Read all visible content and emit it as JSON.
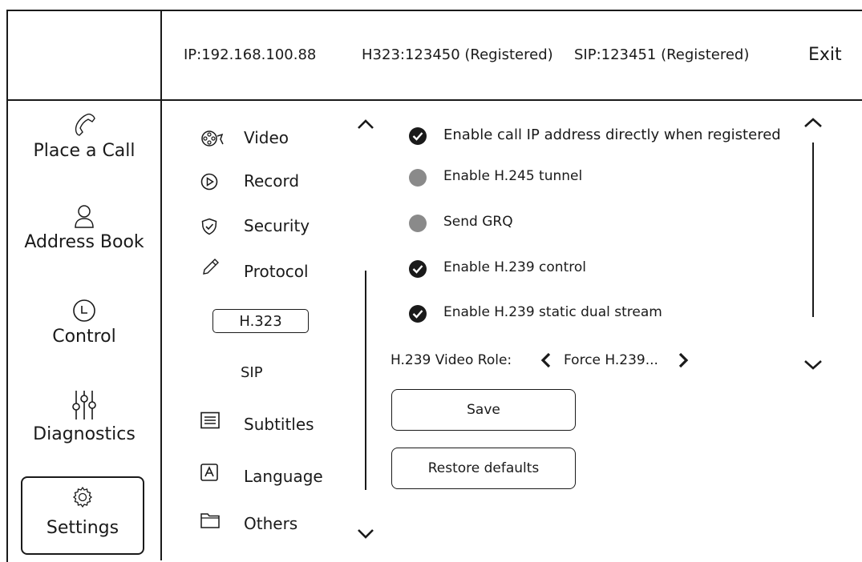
{
  "header": {
    "ip": "IP:192.168.100.88",
    "h323": "H323:123450 (Registered)",
    "sip": "SIP:123451 (Registered)",
    "exit_label": "Exit"
  },
  "sidebar": {
    "items": [
      {
        "label": "Place a Call",
        "icon": "phone-icon"
      },
      {
        "label": "Address Book",
        "icon": "person-icon"
      },
      {
        "label": "Control",
        "icon": "clock-icon"
      },
      {
        "label": "Diagnostics",
        "icon": "sliders-icon"
      },
      {
        "label": "Settings",
        "icon": "gear-icon",
        "selected": true
      }
    ]
  },
  "menu": {
    "items": [
      {
        "label": "Video",
        "icon": "video-icon"
      },
      {
        "label": "Record",
        "icon": "record-icon"
      },
      {
        "label": "Security",
        "icon": "shield-icon"
      },
      {
        "label": "Protocol",
        "icon": "pencil-icon"
      },
      {
        "label": "Subtitles",
        "icon": "subtitles-icon"
      },
      {
        "label": "Language",
        "icon": "language-icon"
      },
      {
        "label": "Others",
        "icon": "folder-icon"
      }
    ],
    "sub_items": [
      {
        "label": "H.323",
        "selected": true
      },
      {
        "label": "SIP",
        "selected": false
      }
    ]
  },
  "options": [
    {
      "label": "Enable call IP address directly when registered",
      "checked": true
    },
    {
      "label": "Enable H.245 tunnel",
      "checked": false
    },
    {
      "label": "Send GRQ",
      "checked": false
    },
    {
      "label": "Enable H.239 control",
      "checked": true
    },
    {
      "label": "Enable H.239 static dual stream",
      "checked": true
    }
  ],
  "video_role": {
    "label": "H.239 Video Role:",
    "value": "Force H.239..."
  },
  "buttons": {
    "save": "Save",
    "restore": "Restore defaults"
  }
}
